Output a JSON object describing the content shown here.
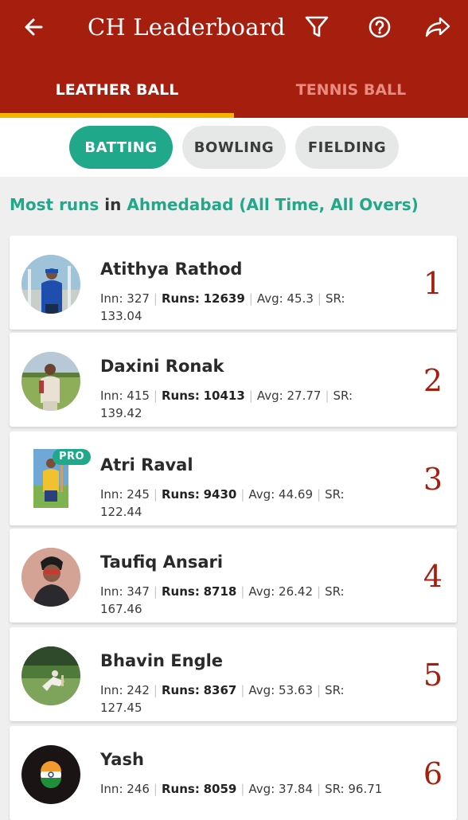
{
  "appbar": {
    "title": "CH Leaderboard",
    "back_icon": "back-arrow-icon",
    "filter_icon": "filter-icon",
    "help_icon": "help-icon",
    "share_icon": "share-icon",
    "background": "#a61e0e"
  },
  "tabs": [
    {
      "label": "LEATHER BALL",
      "active": true
    },
    {
      "label": "TENNIS BALL",
      "active": false
    }
  ],
  "chips": [
    {
      "label": "BATTING",
      "active": true
    },
    {
      "label": "BOWLING",
      "active": false
    },
    {
      "label": "FIELDING",
      "active": false
    }
  ],
  "heading": {
    "metric": "Most runs",
    "connector": "in",
    "scope": "Ahmedabad (All Time, All Overs)"
  },
  "stat_labels": {
    "inn": "Inn:",
    "runs": "Runs:",
    "avg": "Avg:",
    "sr": "SR:"
  },
  "players": [
    {
      "rank": "1",
      "name": "Atithya Rathod",
      "inn": "327",
      "runs": "12639",
      "avg": "45.3",
      "sr": "133.04",
      "pro": false
    },
    {
      "rank": "2",
      "name": "Daxini Ronak",
      "inn": "415",
      "runs": "10413",
      "avg": "27.77",
      "sr": "139.42",
      "pro": false
    },
    {
      "rank": "3",
      "name": "Atri Raval",
      "inn": "245",
      "runs": "9430",
      "avg": "44.69",
      "sr": "122.44",
      "pro": true,
      "pro_label": "PRO"
    },
    {
      "rank": "4",
      "name": "Taufiq Ansari",
      "inn": "347",
      "runs": "8718",
      "avg": "26.42",
      "sr": "167.46",
      "pro": false
    },
    {
      "rank": "5",
      "name": "Bhavin Engle",
      "inn": "242",
      "runs": "8367",
      "avg": "53.63",
      "sr": "127.45",
      "pro": false
    },
    {
      "rank": "6",
      "name": "Yash",
      "inn": "246",
      "runs": "8059",
      "avg": "37.84",
      "sr": "96.71",
      "pro": false
    }
  ],
  "colors": {
    "accent_green": "#1fa98a",
    "rank_red": "#a61e0e",
    "tab_indicator": "#f5b400"
  }
}
